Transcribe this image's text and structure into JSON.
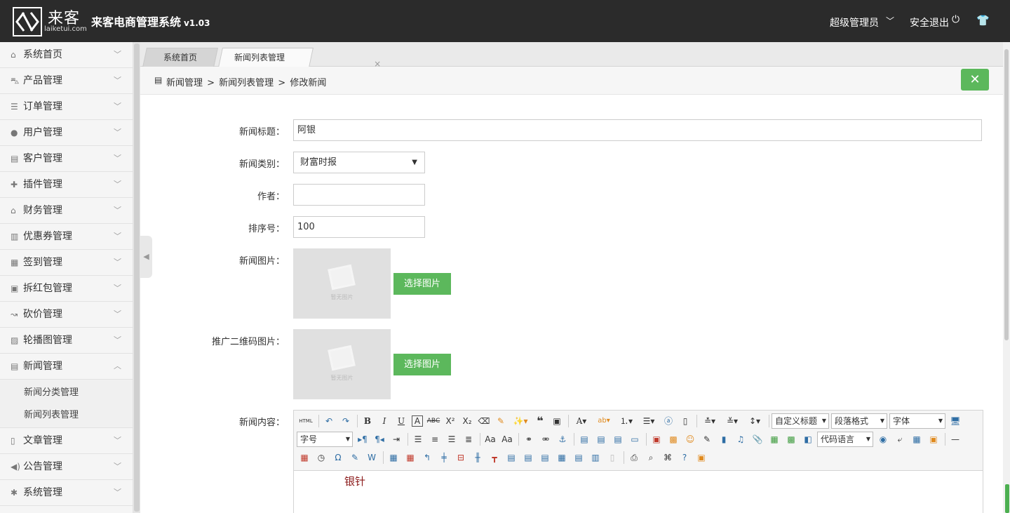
{
  "header": {
    "logo_cn": "来客",
    "logo_en": "laiketui.com",
    "title": "来客电商管理系统",
    "version": "v1.03",
    "admin": "超级管理员",
    "logout": "安全退出"
  },
  "sidebar": {
    "items": [
      {
        "label": "系统首页",
        "icon": "home-icon"
      },
      {
        "label": "产品管理",
        "icon": "bag-icon"
      },
      {
        "label": "订单管理",
        "icon": "order-icon"
      },
      {
        "label": "用户管理",
        "icon": "user-icon"
      },
      {
        "label": "客户管理",
        "icon": "customer-icon"
      },
      {
        "label": "插件管理",
        "icon": "puzzle-icon"
      },
      {
        "label": "财务管理",
        "icon": "bank-icon"
      },
      {
        "label": "优惠券管理",
        "icon": "coupon-icon"
      },
      {
        "label": "签到管理",
        "icon": "checkin-icon"
      },
      {
        "label": "拆红包管理",
        "icon": "redpacket-icon"
      },
      {
        "label": "砍价管理",
        "icon": "bargain-icon"
      },
      {
        "label": "轮播图管理",
        "icon": "image-icon"
      },
      {
        "label": "新闻管理",
        "icon": "news-icon"
      }
    ],
    "news_sub": [
      "新闻分类管理",
      "新闻列表管理"
    ],
    "bottom_items": [
      {
        "label": "文章管理",
        "icon": "file-icon"
      },
      {
        "label": "公告管理",
        "icon": "speaker-icon"
      },
      {
        "label": "系统管理",
        "icon": "gear-icon"
      }
    ]
  },
  "tabs": {
    "home": "系统首页",
    "news": "新闻列表管理"
  },
  "breadcrumb": {
    "text": "新闻管理 > 新闻列表管理 > 修改新闻"
  },
  "form": {
    "title_label": "新闻标题：",
    "title_value": "阿银",
    "category_label": "新闻类别：",
    "category_value": "财富时报",
    "author_label": "作者：",
    "author_value": "",
    "sort_label": "排序号：",
    "sort_value": "100",
    "image_label": "新闻图片：",
    "qr_label": "推广二维码图片：",
    "no_image": "暂无图片",
    "pick_button": "选择图片",
    "content_label": "新闻内容："
  },
  "editor": {
    "custom_title": "自定义标题",
    "paragraph": "段落格式",
    "font": "字体",
    "font_size": "字号",
    "code_lang": "代码语言",
    "html_label": "HTML",
    "content": "银针"
  }
}
